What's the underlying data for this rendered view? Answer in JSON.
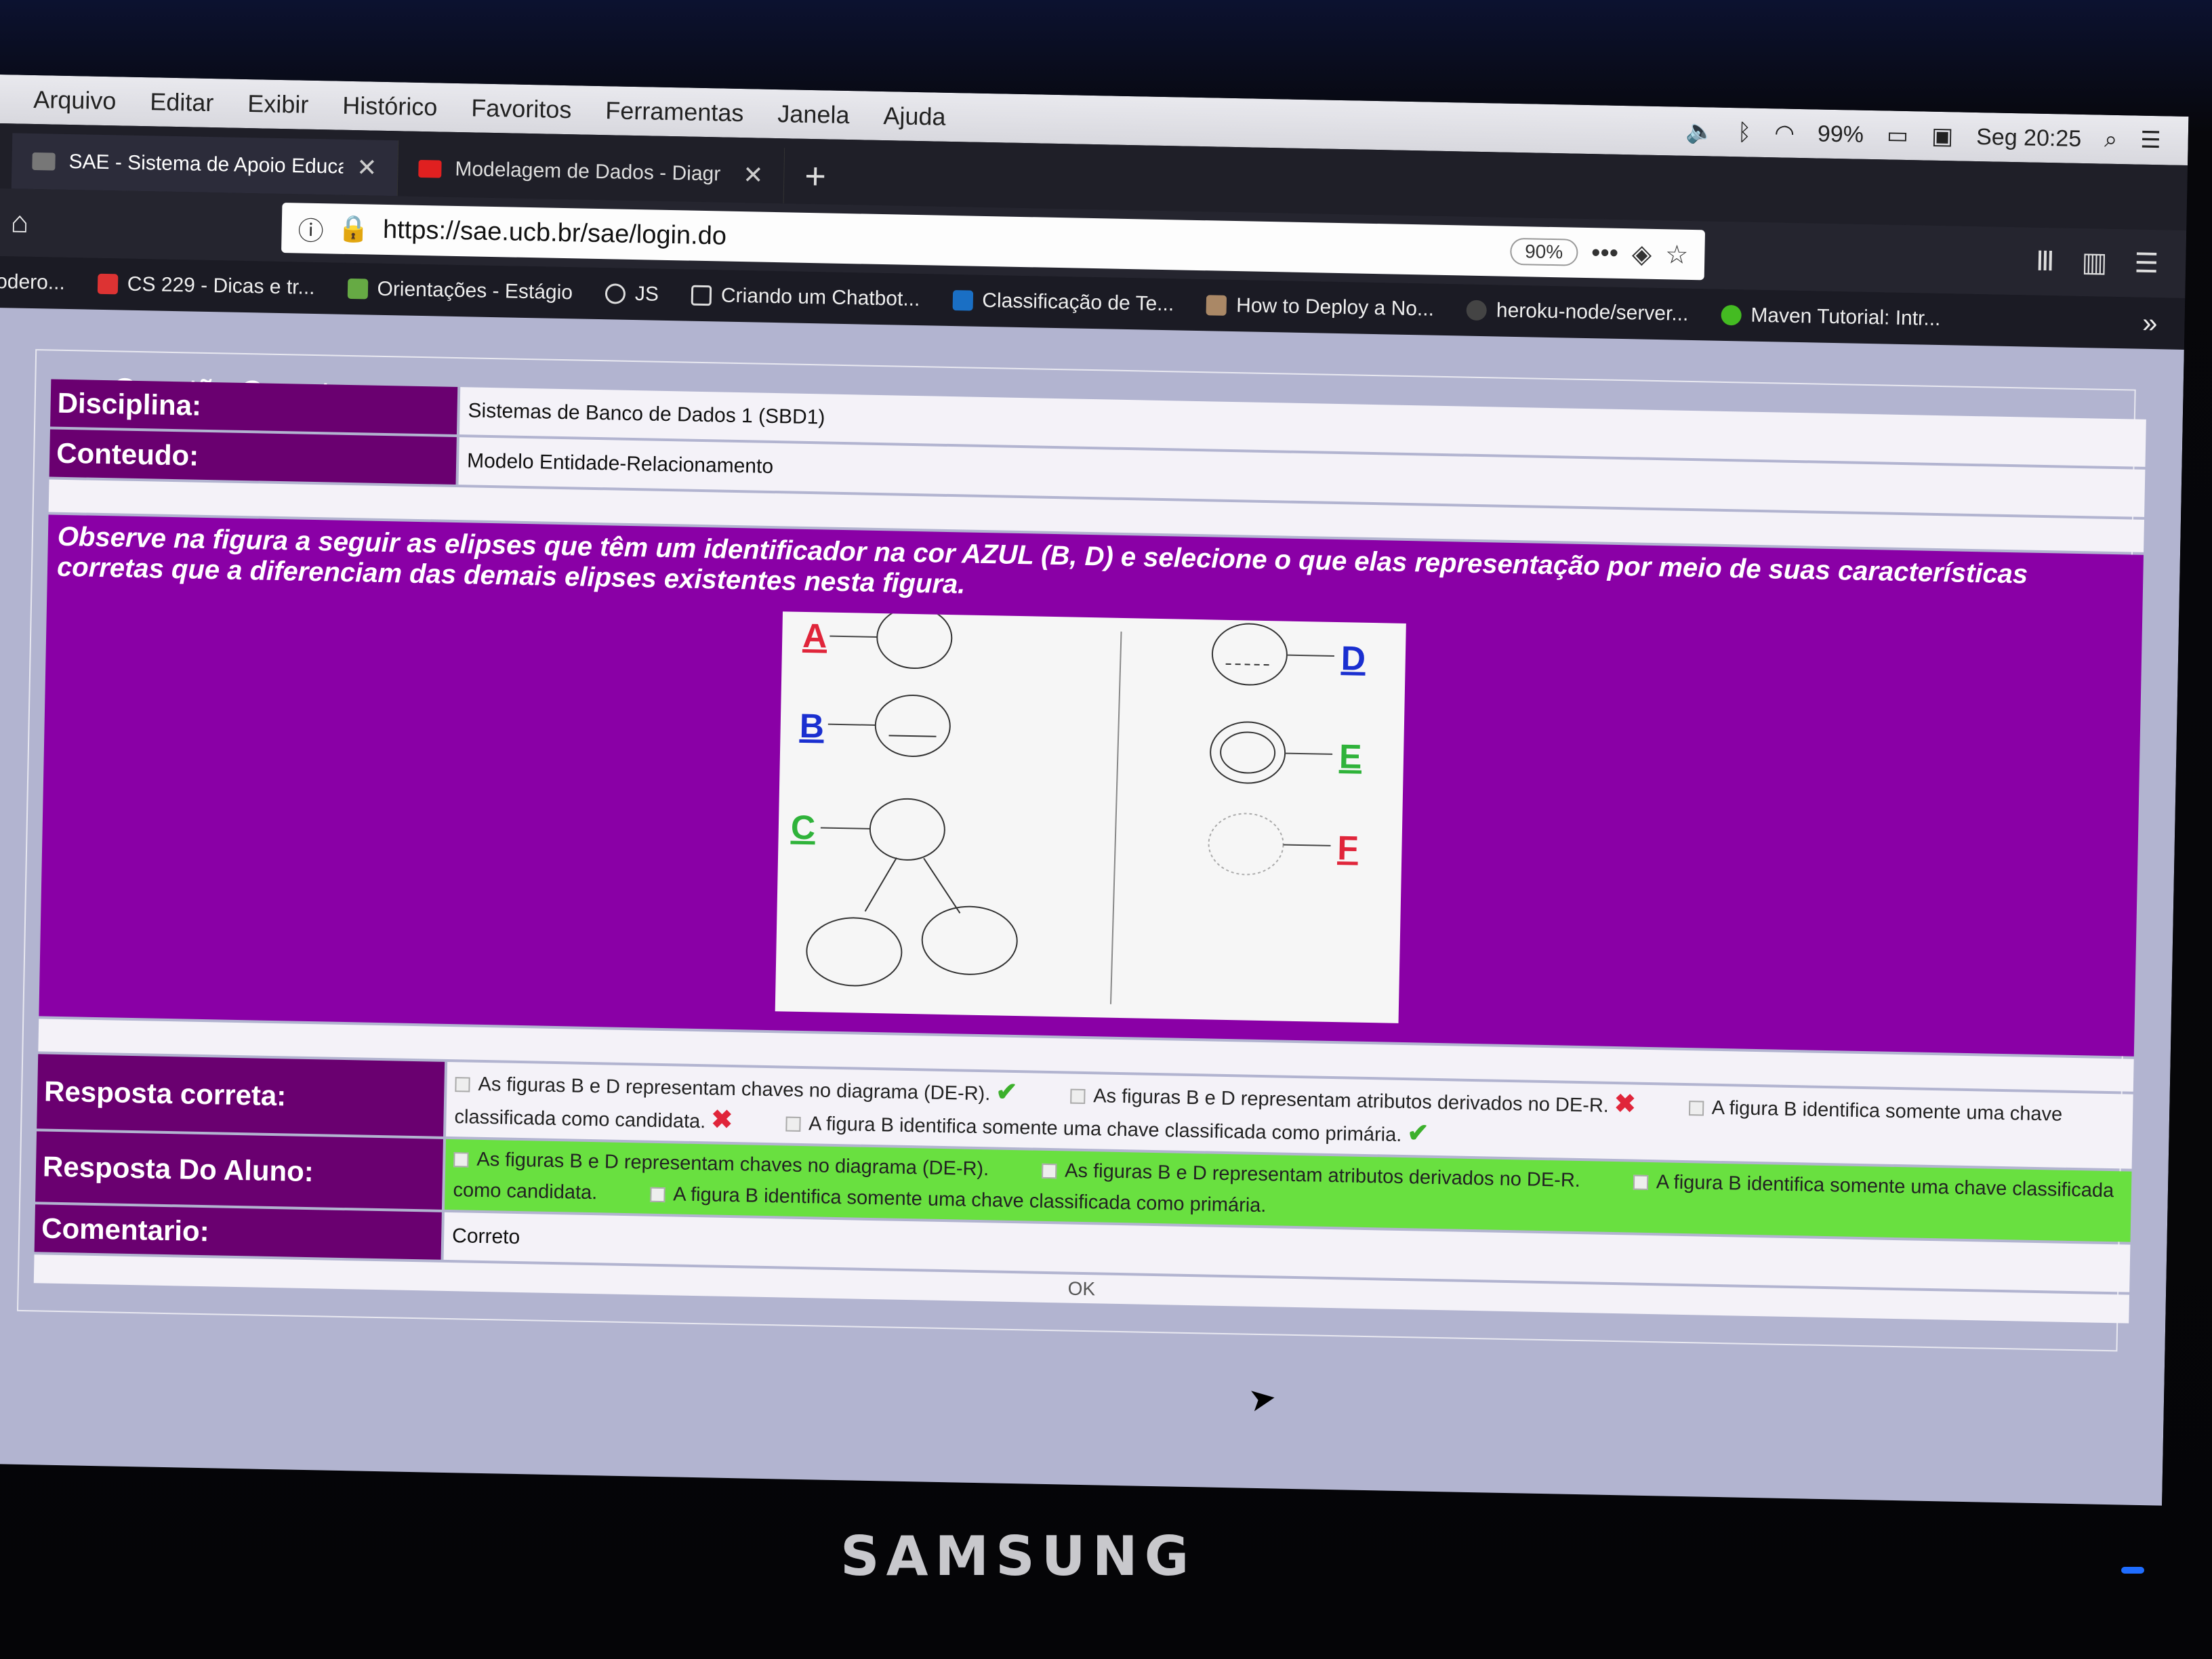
{
  "menu": [
    "Arquivo",
    "Editar",
    "Exibir",
    "Histórico",
    "Favoritos",
    "Ferramentas",
    "Janela",
    "Ajuda"
  ],
  "system": {
    "battery": "99%",
    "clock": "Seg 20:25"
  },
  "tabs": [
    {
      "title": "SAE - Sistema de Apoio Educa",
      "favicon_color": "#777777"
    },
    {
      "title": "Modelagem de Dados - Diagr",
      "favicon_color": "#e02020"
    }
  ],
  "url": "https://sae.ucb.br/sae/login.do",
  "zoom": "90%",
  "bookmarks": [
    "odero...",
    "CS 229 - Dicas e tr...",
    "Orientações - Estágio",
    "JS",
    "Criando um Chatbot...",
    "Classificação de Te...",
    "How to Deploy a No...",
    "heroku-node/server...",
    "Maven Tutorial: Intr..."
  ],
  "page": {
    "legend": "Questão Correta",
    "disciplina_label": "Disciplina:",
    "disciplina_value": "Sistemas de Banco de Dados 1 (SBD1)",
    "conteudo_label": "Conteudo:",
    "conteudo_value": "Modelo Entidade-Relacionamento",
    "question": "Observe na figura a seguir as elipses que têm um identificador na cor AZUL (B, D) e selecione o que elas representação por meio de suas características corretas que a  diferenciam das demais elipses existentes nesta figura.",
    "figure_labels": {
      "A": "A",
      "B": "B",
      "C": "C",
      "D": "D",
      "E": "E",
      "F": "F"
    },
    "colors": {
      "red": "#e0253a",
      "blue": "#1a2fd0",
      "green": "#2fb33a",
      "purple": "#8a00a6",
      "label_bg": "#6a0070"
    },
    "resposta_correta_label": "Resposta correta:",
    "resposta_aluno_label": "Resposta Do Aluno:",
    "comentario_label": "Comentario:",
    "comentario_value": "Correto",
    "ok_label": "OK",
    "options": [
      "As figuras B e D representam chaves no diagrama (DE-R).",
      "As figuras B e D representam atributos derivados no DE-R.",
      "A figura B identifica somente uma chave classificada como candidata.",
      "A figura B identifica somente uma chave classificada como primária."
    ]
  },
  "monitor_brand": "SAMSUNG"
}
